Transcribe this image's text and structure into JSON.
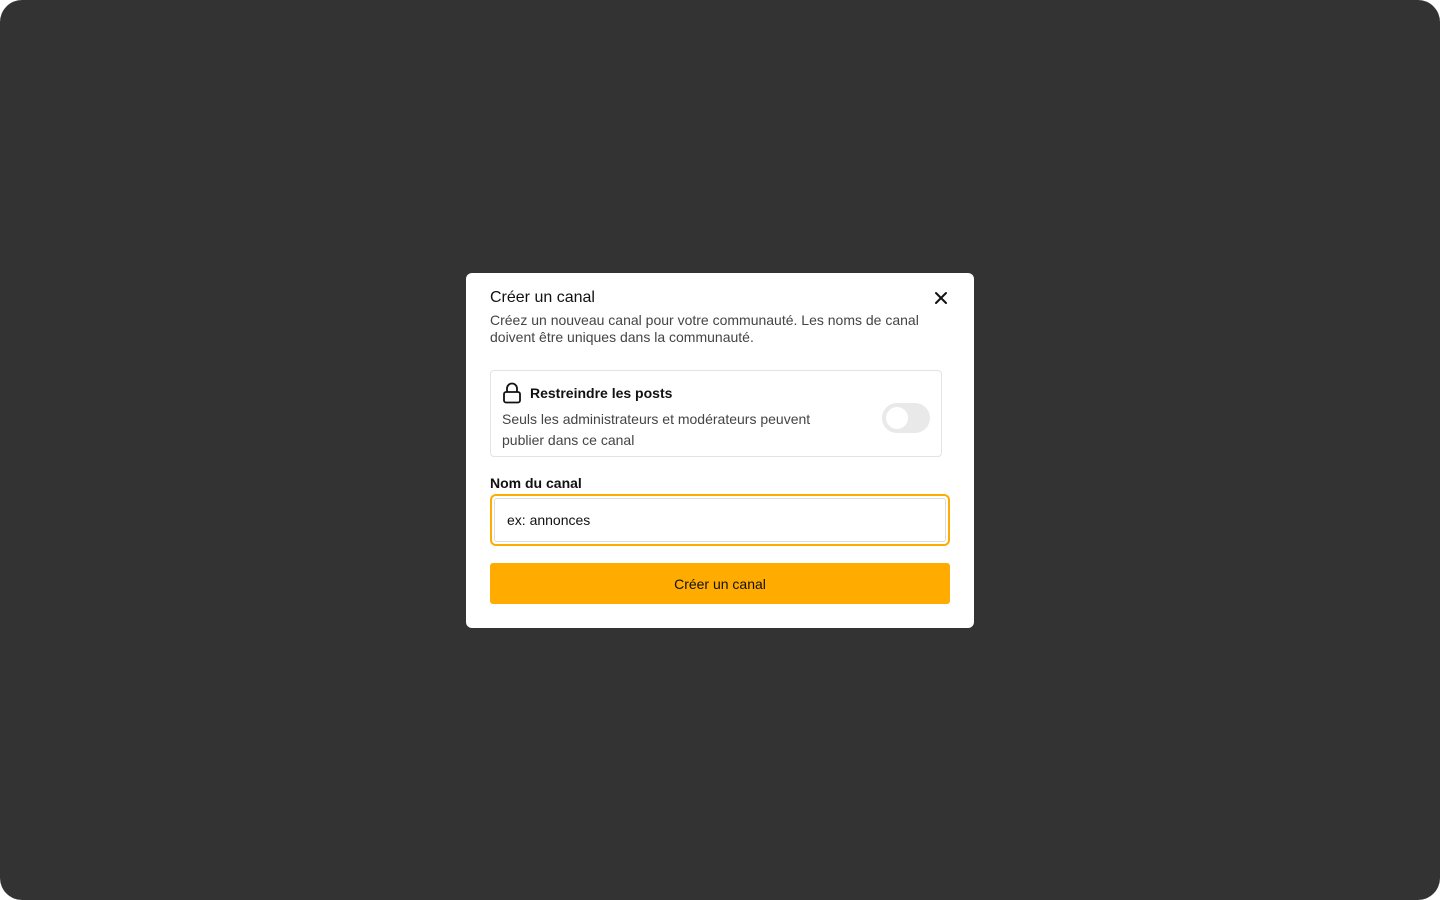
{
  "modal": {
    "title": "Créer un canal",
    "description": "Créez un nouveau canal pour votre communauté. Les noms de canal doivent être uniques dans la communauté.",
    "close_icon": "close-icon"
  },
  "restrict": {
    "icon": "lock-icon",
    "title": "Restreindre les posts",
    "description": "Seuls les administrateurs et modérateurs peuvent publier dans ce canal",
    "enabled": false
  },
  "channel_name": {
    "label": "Nom du canal",
    "placeholder": "ex: annonces",
    "value": ""
  },
  "submit": {
    "label": "Créer un canal"
  },
  "colors": {
    "backdrop": "#333333",
    "accent": "#ffab00",
    "toggle_off": "#e9e9e9"
  }
}
